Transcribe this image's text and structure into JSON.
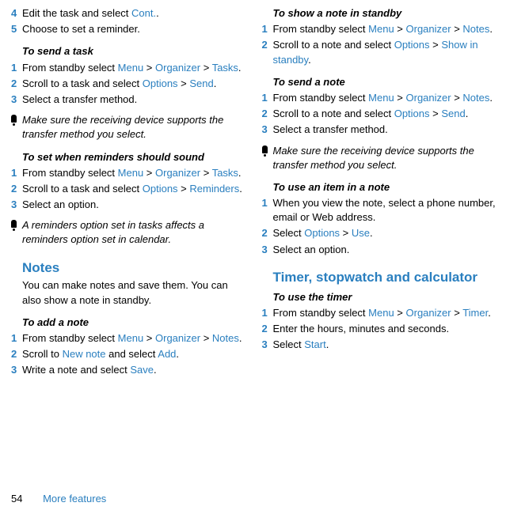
{
  "col1": {
    "steps_a": [
      {
        "num": "4",
        "parts": [
          "Edit the task and select ",
          {
            "link": "Cont."
          },
          "."
        ]
      },
      {
        "num": "5",
        "parts": [
          "Choose to set a reminder."
        ]
      }
    ],
    "sub_send_task": "To send a task",
    "steps_send_task": [
      {
        "num": "1",
        "parts": [
          "From standby select ",
          {
            "link": "Menu"
          },
          " > ",
          {
            "link": "Organizer"
          },
          " > ",
          {
            "link": "Tasks"
          },
          "."
        ]
      },
      {
        "num": "2",
        "parts": [
          "Scroll to a task and select ",
          {
            "link": "Options"
          },
          " > ",
          {
            "link": "Send"
          },
          "."
        ]
      },
      {
        "num": "3",
        "parts": [
          "Select a transfer method."
        ]
      }
    ],
    "note1": "Make sure the receiving device supports the transfer method you select.",
    "sub_set_reminders": "To set when reminders should sound",
    "steps_reminders": [
      {
        "num": "1",
        "parts": [
          "From standby select ",
          {
            "link": "Menu"
          },
          " > ",
          {
            "link": "Organizer"
          },
          " > ",
          {
            "link": "Tasks"
          },
          "."
        ]
      },
      {
        "num": "2",
        "parts": [
          "Scroll to a task and select ",
          {
            "link": "Options"
          },
          " > ",
          {
            "link": "Reminders"
          },
          "."
        ]
      },
      {
        "num": "3",
        "parts": [
          "Select an option."
        ]
      }
    ],
    "note2": "A reminders option set in tasks affects a reminders option set in calendar.",
    "h2_notes": "Notes",
    "notes_body": "You can make notes and save them. You can also show a note in standby.",
    "sub_add_note": "To add a note",
    "steps_add_note": [
      {
        "num": "1",
        "parts": [
          "From standby select ",
          {
            "link": "Menu"
          },
          " > ",
          {
            "link": "Organizer"
          },
          " > ",
          {
            "link": "Notes"
          },
          "."
        ]
      },
      {
        "num": "2",
        "parts": [
          "Scroll to ",
          {
            "link": "New note"
          },
          " and select ",
          {
            "link": "Add"
          },
          "."
        ]
      },
      {
        "num": "3",
        "parts": [
          "Write a note and select ",
          {
            "link": "Save"
          },
          "."
        ]
      }
    ]
  },
  "col2": {
    "sub_show_note": "To show a note in standby",
    "steps_show_note": [
      {
        "num": "1",
        "parts": [
          "From standby select ",
          {
            "link": "Menu"
          },
          " > ",
          {
            "link": "Organizer"
          },
          " > ",
          {
            "link": "Notes"
          },
          "."
        ]
      },
      {
        "num": "2",
        "parts": [
          "Scroll to a note and select ",
          {
            "link": "Options"
          },
          " > ",
          {
            "link": "Show in standby"
          },
          "."
        ]
      }
    ],
    "sub_send_note": "To send a note",
    "steps_send_note": [
      {
        "num": "1",
        "parts": [
          "From standby select ",
          {
            "link": "Menu"
          },
          " > ",
          {
            "link": "Organizer"
          },
          " > ",
          {
            "link": "Notes"
          },
          "."
        ]
      },
      {
        "num": "2",
        "parts": [
          "Scroll to a note and select ",
          {
            "link": "Options"
          },
          " > ",
          {
            "link": "Send"
          },
          "."
        ]
      },
      {
        "num": "3",
        "parts": [
          "Select a transfer method."
        ]
      }
    ],
    "note3": "Make sure the receiving device supports the transfer method you select.",
    "sub_use_item": "To use an item in a note",
    "steps_use_item": [
      {
        "num": "1",
        "parts": [
          "When you view the note, select a phone number, email or Web address."
        ]
      },
      {
        "num": "2",
        "parts": [
          "Select ",
          {
            "link": "Options"
          },
          " > ",
          {
            "link": "Use"
          },
          "."
        ]
      },
      {
        "num": "3",
        "parts": [
          "Select an option."
        ]
      }
    ],
    "h2_timer": "Timer, stopwatch and calculator",
    "sub_use_timer": "To use the timer",
    "steps_use_timer": [
      {
        "num": "1",
        "parts": [
          "From standby select ",
          {
            "link": "Menu"
          },
          " > ",
          {
            "link": "Organizer"
          },
          " > ",
          {
            "link": "Timer"
          },
          "."
        ]
      },
      {
        "num": "2",
        "parts": [
          "Enter the hours, minutes and seconds."
        ]
      },
      {
        "num": "3",
        "parts": [
          "Select ",
          {
            "link": "Start"
          },
          "."
        ]
      }
    ]
  },
  "footer": {
    "page": "54",
    "section": "More features"
  }
}
